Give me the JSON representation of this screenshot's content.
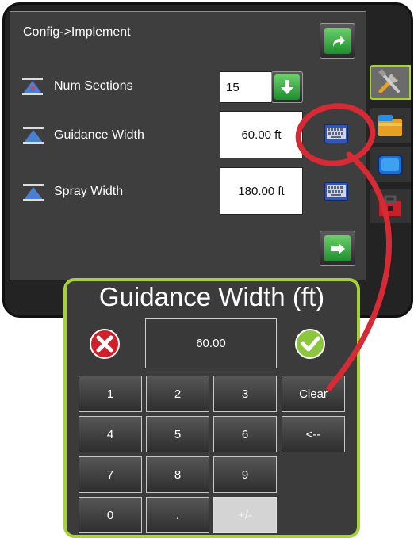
{
  "screen": {
    "title": "Config->Implement",
    "rows": [
      {
        "label": "Num Sections",
        "value": "15",
        "action_icon": "down-arrow-icon"
      },
      {
        "label": "Guidance Width",
        "value": "60.00 ft",
        "action_icon": "keyboard-icon"
      },
      {
        "label": "Spray Width",
        "value": "180.00 ft",
        "action_icon": "keyboard-icon"
      }
    ],
    "nav": {
      "top_icon": "return-arrow-icon",
      "bottom_icon": "next-arrow-icon"
    }
  },
  "side_tabs": [
    "tools-icon",
    "console-folder-icon",
    "gps-screen-icon",
    "toolbox-icon"
  ],
  "keypad": {
    "title": "Guidance Width (ft)",
    "display_value": "60.00",
    "cancel_icon": "cancel-x-icon",
    "accept_icon": "accept-check-icon",
    "keys": {
      "k1": "1",
      "k2": "2",
      "k3": "3",
      "clear": "Clear",
      "k4": "4",
      "k5": "5",
      "k6": "6",
      "back": "<--",
      "k7": "7",
      "k8": "8",
      "k9": "9",
      "k0": "0",
      "dot": ".",
      "plusminus": "+/-"
    }
  },
  "colors": {
    "accent": "#a7d13b",
    "button_green": "#2eaa3c",
    "annotation_red": "#d62a35",
    "panel": "#3e3e3e"
  }
}
